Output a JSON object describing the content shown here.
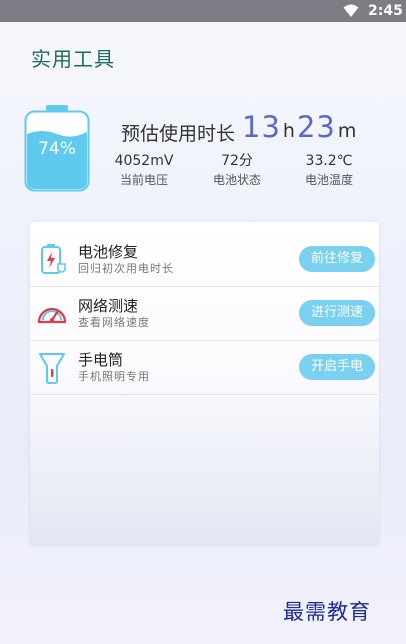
{
  "status_bar": {
    "time": "2:45",
    "wifi_icon": "wifi-icon"
  },
  "app": {
    "title": "实用工具"
  },
  "battery": {
    "percent_label": "74%",
    "level": 0.74,
    "fill_color": "#5fc9ee",
    "estimate_label": "预估使用时长",
    "hours": "13",
    "hours_unit": "h",
    "minutes": "23",
    "minutes_unit": "m",
    "stats": [
      {
        "value": "4052mV",
        "label": "当前电压"
      },
      {
        "value": "72分",
        "label": "电池状态"
      },
      {
        "value": "33.2℃",
        "label": "电池温度"
      }
    ]
  },
  "tools": [
    {
      "icon": "battery-repair-icon",
      "name": "电池修复",
      "desc": "回归初次用电时长",
      "button": "前往修复"
    },
    {
      "icon": "speedometer-icon",
      "name": "网络测速",
      "desc": "查看网络速度",
      "button": "进行测速"
    },
    {
      "icon": "flashlight-icon",
      "name": "手电筒",
      "desc": "手机照明专用",
      "button": "开启手电"
    }
  ],
  "colors": {
    "accent": "#7ad0ef",
    "title": "#1e6a5c",
    "hours_value": "#5a69c9",
    "icon_red": "#e2394b"
  },
  "watermark": "最需教育"
}
